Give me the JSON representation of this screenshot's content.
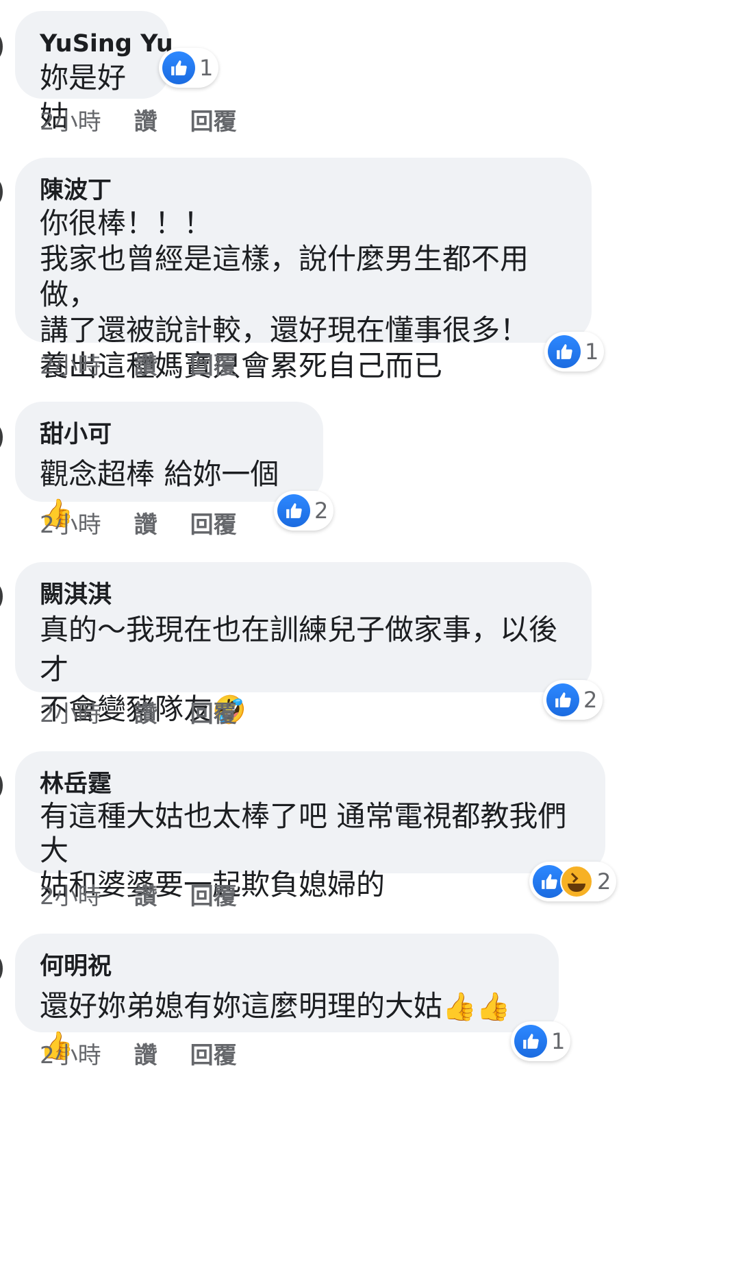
{
  "comments": [
    {
      "author": "YuSing Yu",
      "text": "妳是好姑",
      "time": "2小時",
      "like_label": "讚",
      "reply_label": "回覆",
      "reactions": [
        "like-icon"
      ],
      "reaction_count": "1"
    },
    {
      "author": "陳波丁",
      "text": "你很棒！！！\n我家也曾經是這樣，說什麼男生都不用做，\n講了還被說計較，還好現在懂事很多！\n養出這種媽寶只會累死自己而已",
      "time": "2小時",
      "like_label": "讚",
      "reply_label": "回覆",
      "reactions": [
        "like-icon"
      ],
      "reaction_count": "1"
    },
    {
      "author": "甜小可",
      "text": "觀念超棒 給妳一個",
      "emoji": "👍",
      "time": "2小時",
      "like_label": "讚",
      "reply_label": "回覆",
      "reactions": [
        "like-icon"
      ],
      "reaction_count": "2"
    },
    {
      "author": "闕淇淇",
      "text": "真的～我現在也在訓練兒子做家事，以後才\n不會變豬隊友",
      "emoji": "🤣",
      "time": "2小時",
      "like_label": "讚",
      "reply_label": "回覆",
      "reactions": [
        "like-icon"
      ],
      "reaction_count": "2"
    },
    {
      "author": "林岳霆",
      "text": "有這種大姑也太棒了吧 通常電視都教我們 大\n姑和婆婆要一起欺負媳婦的",
      "time": "2小時",
      "like_label": "讚",
      "reply_label": "回覆",
      "reactions": [
        "like-icon",
        "haha-icon"
      ],
      "reaction_count": "2"
    },
    {
      "author": "何明祝",
      "text": "還好妳弟媳有妳這麼明理的大姑",
      "emoji": "👍👍👍",
      "time": "2小時",
      "like_label": "讚",
      "reply_label": "回覆",
      "reactions": [
        "like-icon"
      ],
      "reaction_count": "1"
    }
  ]
}
